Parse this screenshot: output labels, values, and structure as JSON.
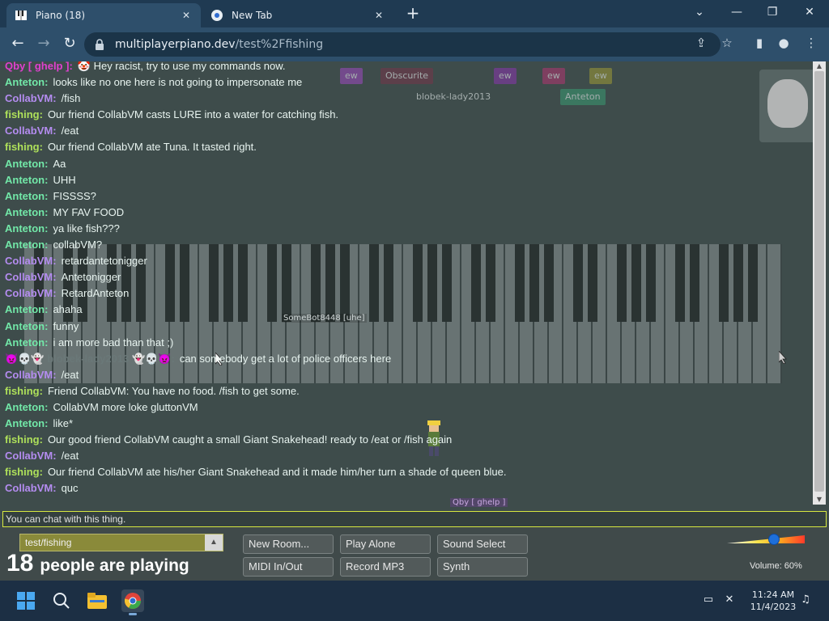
{
  "browser": {
    "tabs": [
      {
        "title": "Piano (18)",
        "active": true
      },
      {
        "title": "New Tab",
        "active": false
      }
    ],
    "url_host": "multiplayerpiano.dev",
    "url_path": "/test%2Ffishing"
  },
  "room": {
    "name": "test/fishing",
    "player_count": "18",
    "players_text": "people are playing"
  },
  "chat": [
    {
      "name": "Qby [ ghelp ]:",
      "style": "qby",
      "text": "🤡 Hey racist, try to use my commands now."
    },
    {
      "name": "Anteton:",
      "style": "ant",
      "text": "looks like no one here is not going to impersonate me"
    },
    {
      "name": "CollabVM:",
      "style": "collab",
      "text": "/fish"
    },
    {
      "name": "fishing:",
      "style": "fish",
      "text": "Our friend CollabVM casts LURE into a water for catching fish."
    },
    {
      "name": "CollabVM:",
      "style": "collab",
      "text": "/eat"
    },
    {
      "name": "fishing:",
      "style": "fish",
      "text": "Our friend CollabVM ate Tuna. It tasted right."
    },
    {
      "name": "Anteton:",
      "style": "ant",
      "text": "Aa"
    },
    {
      "name": "Anteton:",
      "style": "ant",
      "text": "UHH"
    },
    {
      "name": "Anteton:",
      "style": "ant",
      "text": "FISSSS?"
    },
    {
      "name": "Anteton:",
      "style": "ant",
      "text": "MY FAV FOOD"
    },
    {
      "name": "Anteton:",
      "style": "ant",
      "text": "ya like fish???"
    },
    {
      "name": "Anteton:",
      "style": "ant",
      "text": "collabVM?"
    },
    {
      "name": "CollabVM:",
      "style": "collab",
      "text": "retardantetonigger"
    },
    {
      "name": "CollabVM:",
      "style": "collab",
      "text": "Antetonigger"
    },
    {
      "name": "CollabVM:",
      "style": "collab",
      "text": "RetardAnteton"
    },
    {
      "name": "Anteton:",
      "style": "ant",
      "text": "ahaha"
    },
    {
      "name": "Anteton:",
      "style": "ant",
      "text": "funny"
    },
    {
      "name": "Anteton:",
      "style": "ant",
      "text": "i am more bad than that ;)"
    },
    {
      "name": "👿💀👻 blobek-lady2013 👻💀👿:",
      "style": "blob",
      "text": "can somebody get a lot of police officers here"
    },
    {
      "name": "CollabVM:",
      "style": "collab",
      "text": "/eat"
    },
    {
      "name": "fishing:",
      "style": "fish",
      "text": "Friend CollabVM: You have no food. /fish to get some."
    },
    {
      "name": "Anteton:",
      "style": "ant",
      "text": "CollabVM more loke gluttonVM"
    },
    {
      "name": "Anteton:",
      "style": "ant",
      "text": "like*"
    },
    {
      "name": "fishing:",
      "style": "fish",
      "text": "Our good friend CollabVM caught a small Giant Snakehead! ready to /eat or /fish again"
    },
    {
      "name": "CollabVM:",
      "style": "collab",
      "text": "/eat"
    },
    {
      "name": "fishing:",
      "style": "fish",
      "text": "Our friend CollabVM ate his/her Giant Snakehead and it made him/her turn a shade of queen blue."
    },
    {
      "name": "CollabVM:",
      "style": "collab",
      "text": "quc"
    }
  ],
  "user_chips": [
    "ew",
    "Obscurite",
    "ew",
    "ew",
    "ew",
    "blobek-lady2013",
    "Anteton"
  ],
  "chat_placeholder": "You can chat with this thing.",
  "cursor_label_bot": "SomeBot8448 [uhe]",
  "cursor_label_qby": "Qby [ ghelp ]",
  "buttons": {
    "new_room": "New Room...",
    "play_alone": "Play Alone",
    "sound_select": "Sound Select",
    "midi": "MIDI In/Out",
    "record": "Record MP3",
    "synth": "Synth"
  },
  "volume": {
    "label": "Volume: 60%",
    "value": 0.6
  },
  "taskbar": {
    "time": "11:24 AM",
    "date": "11/4/2023"
  },
  "colors": {
    "collab": "#b48cf0",
    "fishing": "#aee05a",
    "anteton": "#72e8a8",
    "qby": "#e040d0"
  }
}
